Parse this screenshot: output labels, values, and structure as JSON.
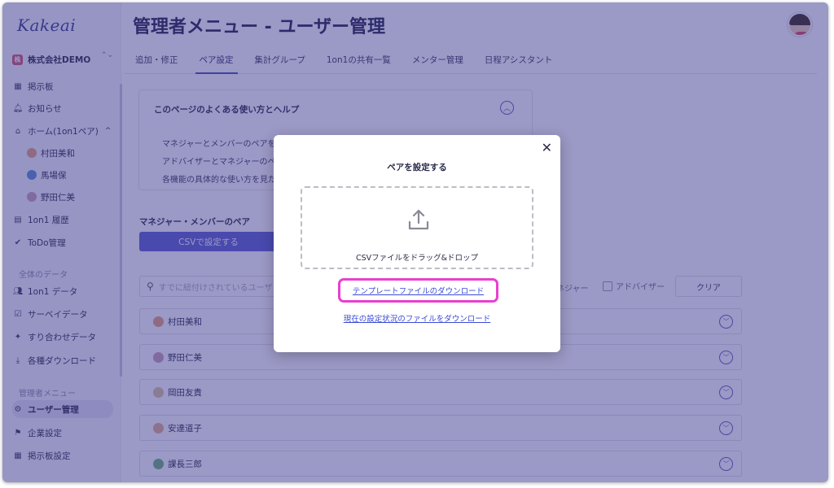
{
  "app": {
    "logo": "Kakeai",
    "page_title": "管理者メニュー - ユーザー管理"
  },
  "sidebar": {
    "company": "株式会社DEMO",
    "company_badge": "株",
    "items": [
      {
        "label": "掲示板",
        "icon": "bulletin-icon"
      },
      {
        "label": "お知らせ",
        "icon": "bell-icon"
      },
      {
        "label": "ホーム(1on1ペア)",
        "icon": "home-icon"
      },
      {
        "label": "村田美和",
        "icon": "avatar"
      },
      {
        "label": "馬場保",
        "icon": "avatar"
      },
      {
        "label": "野田仁美",
        "icon": "avatar"
      },
      {
        "label": "1on1 履歴",
        "icon": "history-icon"
      },
      {
        "label": "ToDo管理",
        "icon": "check-icon"
      },
      {
        "label": "1on1 データ",
        "icon": "users-icon"
      },
      {
        "label": "サーベイデータ",
        "icon": "survey-icon"
      },
      {
        "label": "すり合わせデータ",
        "icon": "handshake-icon"
      },
      {
        "label": "各種ダウンロード",
        "icon": "download-icon"
      },
      {
        "label": "ユーザー管理",
        "icon": "user-admin-icon"
      },
      {
        "label": "企業設定",
        "icon": "company-icon"
      },
      {
        "label": "掲示板設定",
        "icon": "bulletin-settings-icon"
      }
    ],
    "section_data": "全体のデータ",
    "section_admin": "管理者メニュー",
    "home_chevron": "^",
    "updown": "⌃⌄"
  },
  "tabs": [
    "追加・修正",
    "ペア設定",
    "集計グループ",
    "1on1の共有一覧",
    "メンター管理",
    "日程アシスタント"
  ],
  "active_tab": "ペア設定",
  "help": {
    "title": "このページのよくある使い方とヘルプ",
    "lines": [
      "マネジャーとメンバーのペアを",
      "アドバイザーとマネジャーのペ",
      "各機能の具体的な使い方を見た"
    ]
  },
  "pairs": {
    "title": "マネジャー・メンバーのペア",
    "csv_button": "CSVで設定する",
    "search_placeholder": "すでに紐付けされているユーザ",
    "filter_manager": "ネジャー",
    "filter_advisor": "アドバイザー",
    "clear": "クリア",
    "rows": [
      "村田美和",
      "野田仁美",
      "岡田友貴",
      "安達道子",
      "課長三郎"
    ]
  },
  "modal": {
    "close": "✕",
    "title": "ペアを設定する",
    "dropzone_label": "CSVファイルをドラッグ&ドロップ",
    "template_link": "テンプレートファイルのダウンロード",
    "current_link": "現在の設定状況のファイルをダウンロード"
  },
  "colors": {
    "highlight": "#e93fcf",
    "overlay": "#37348c",
    "primary": "#5b5fd1",
    "link": "#3a4bd6"
  }
}
